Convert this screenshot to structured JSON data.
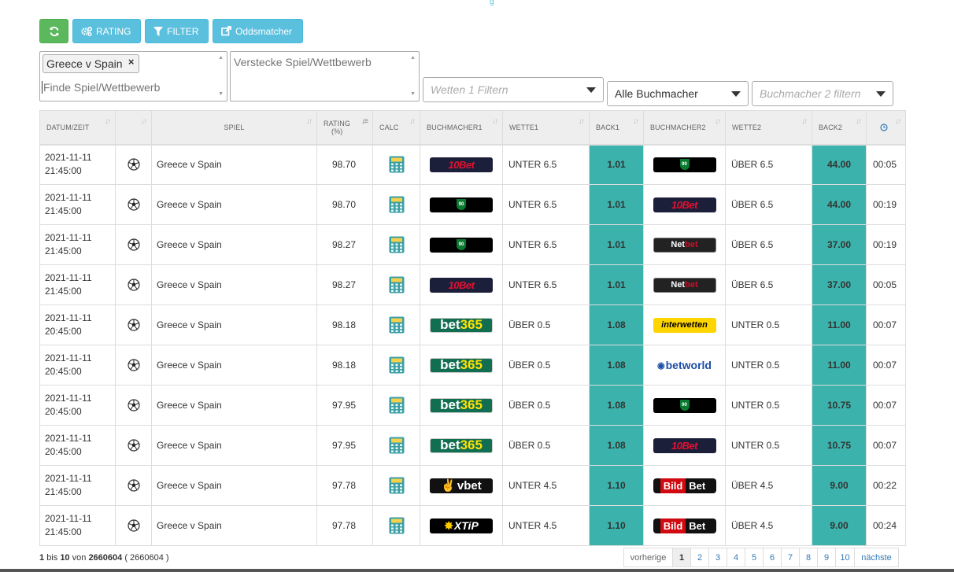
{
  "toolbar": {
    "refresh_icon": "refresh-icon",
    "rating_label": "RATING",
    "filter_label": "FILTER",
    "oddsmatcher_label": "Oddsmatcher",
    "accent_green": "#5cb85c",
    "accent_info": "#5bc0de"
  },
  "filters": {
    "selected_tag": "Greece v Spain",
    "tag_remove": "×",
    "find_placeholder": "Finde Spiel/Wettbewerb",
    "hide_placeholder": "Verstecke Spiel/Wettbewerb",
    "bets_placeholder": "Wetten 1 Filtern",
    "bookmaker_value": "Alle Buchmacher",
    "bookmaker2_placeholder": "Buchmacher 2 filtern"
  },
  "table": {
    "headers": {
      "date": "DATUM/ZEIT",
      "game": "SPIEL",
      "rating_line1": "RATING",
      "rating_line2": "(%)",
      "calc": "CALC",
      "bm1": "BUCHMACHER1",
      "bet1": "WETTE1",
      "back1": "BACK1",
      "bm2": "BUCHMACHER2",
      "bet2": "WETTE2",
      "back2": "BACK2",
      "time_icon": "clock-icon"
    },
    "back_color": "#3bb3ac",
    "rows": [
      {
        "date": "2021-11-11",
        "time": "21:45:00",
        "game": "Greece v Spain",
        "rating": "98.70",
        "bm1": "10bet",
        "bet1": "UNTER 6.5",
        "back1": "1.01",
        "bm2": "90",
        "bet2": "ÜBER 6.5",
        "back2": "44.00",
        "age": "00:05"
      },
      {
        "date": "2021-11-11",
        "time": "21:45:00",
        "game": "Greece v Spain",
        "rating": "98.70",
        "bm1": "90",
        "bet1": "UNTER 6.5",
        "back1": "1.01",
        "bm2": "10bet",
        "bet2": "ÜBER 6.5",
        "back2": "44.00",
        "age": "00:19"
      },
      {
        "date": "2021-11-11",
        "time": "21:45:00",
        "game": "Greece v Spain",
        "rating": "98.27",
        "bm1": "90",
        "bet1": "UNTER 6.5",
        "back1": "1.01",
        "bm2": "netbet",
        "bet2": "ÜBER 6.5",
        "back2": "37.00",
        "age": "00:19"
      },
      {
        "date": "2021-11-11",
        "time": "21:45:00",
        "game": "Greece v Spain",
        "rating": "98.27",
        "bm1": "10bet",
        "bet1": "UNTER 6.5",
        "back1": "1.01",
        "bm2": "netbet",
        "bet2": "ÜBER 6.5",
        "back2": "37.00",
        "age": "00:05"
      },
      {
        "date": "2021-11-11",
        "time": "20:45:00",
        "game": "Greece v Spain",
        "rating": "98.18",
        "bm1": "bet365",
        "bet1": "ÜBER 0.5",
        "back1": "1.08",
        "bm2": "interwetten",
        "bet2": "UNTER 0.5",
        "back2": "11.00",
        "age": "00:07"
      },
      {
        "date": "2021-11-11",
        "time": "20:45:00",
        "game": "Greece v Spain",
        "rating": "98.18",
        "bm1": "bet365",
        "bet1": "ÜBER 0.5",
        "back1": "1.08",
        "bm2": "betworld",
        "bet2": "UNTER 0.5",
        "back2": "11.00",
        "age": "00:07"
      },
      {
        "date": "2021-11-11",
        "time": "20:45:00",
        "game": "Greece v Spain",
        "rating": "97.95",
        "bm1": "bet365",
        "bet1": "ÜBER 0.5",
        "back1": "1.08",
        "bm2": "90",
        "bet2": "UNTER 0.5",
        "back2": "10.75",
        "age": "00:07"
      },
      {
        "date": "2021-11-11",
        "time": "20:45:00",
        "game": "Greece v Spain",
        "rating": "97.95",
        "bm1": "bet365",
        "bet1": "ÜBER 0.5",
        "back1": "1.08",
        "bm2": "10bet",
        "bet2": "UNTER 0.5",
        "back2": "10.75",
        "age": "00:07"
      },
      {
        "date": "2021-11-11",
        "time": "21:45:00",
        "game": "Greece v Spain",
        "rating": "97.78",
        "bm1": "vbet",
        "bet1": "UNTER 4.5",
        "back1": "1.10",
        "bm2": "bildbet",
        "bet2": "ÜBER 4.5",
        "back2": "9.00",
        "age": "00:22"
      },
      {
        "date": "2021-11-11",
        "time": "21:45:00",
        "game": "Greece v Spain",
        "rating": "97.78",
        "bm1": "xtip",
        "bet1": "UNTER 4.5",
        "back1": "1.10",
        "bm2": "bildbet",
        "bet2": "ÜBER 4.5",
        "back2": "9.00",
        "age": "00:24"
      }
    ]
  },
  "logos": {
    "10bet": "10Bet",
    "90": "90",
    "netbet_a": "Net",
    "netbet_b": "bet",
    "bet365_a": "bet",
    "bet365_b": "365",
    "interwetten": "interwetten",
    "betworld": "betworld",
    "vbet": "vbet",
    "bildbet_a": "Bild",
    "bildbet_b": "Bet",
    "xtip": "XTiP"
  },
  "pagination": {
    "from": "1",
    "bis": "bis",
    "to": "10",
    "von": "von",
    "total": "2660604",
    "total_paren": "( 2660604 )",
    "prev": "vorherige",
    "next": "nächste",
    "pages": [
      "1",
      "2",
      "3",
      "4",
      "5",
      "6",
      "7",
      "8",
      "9",
      "10"
    ],
    "active_page": "1"
  }
}
